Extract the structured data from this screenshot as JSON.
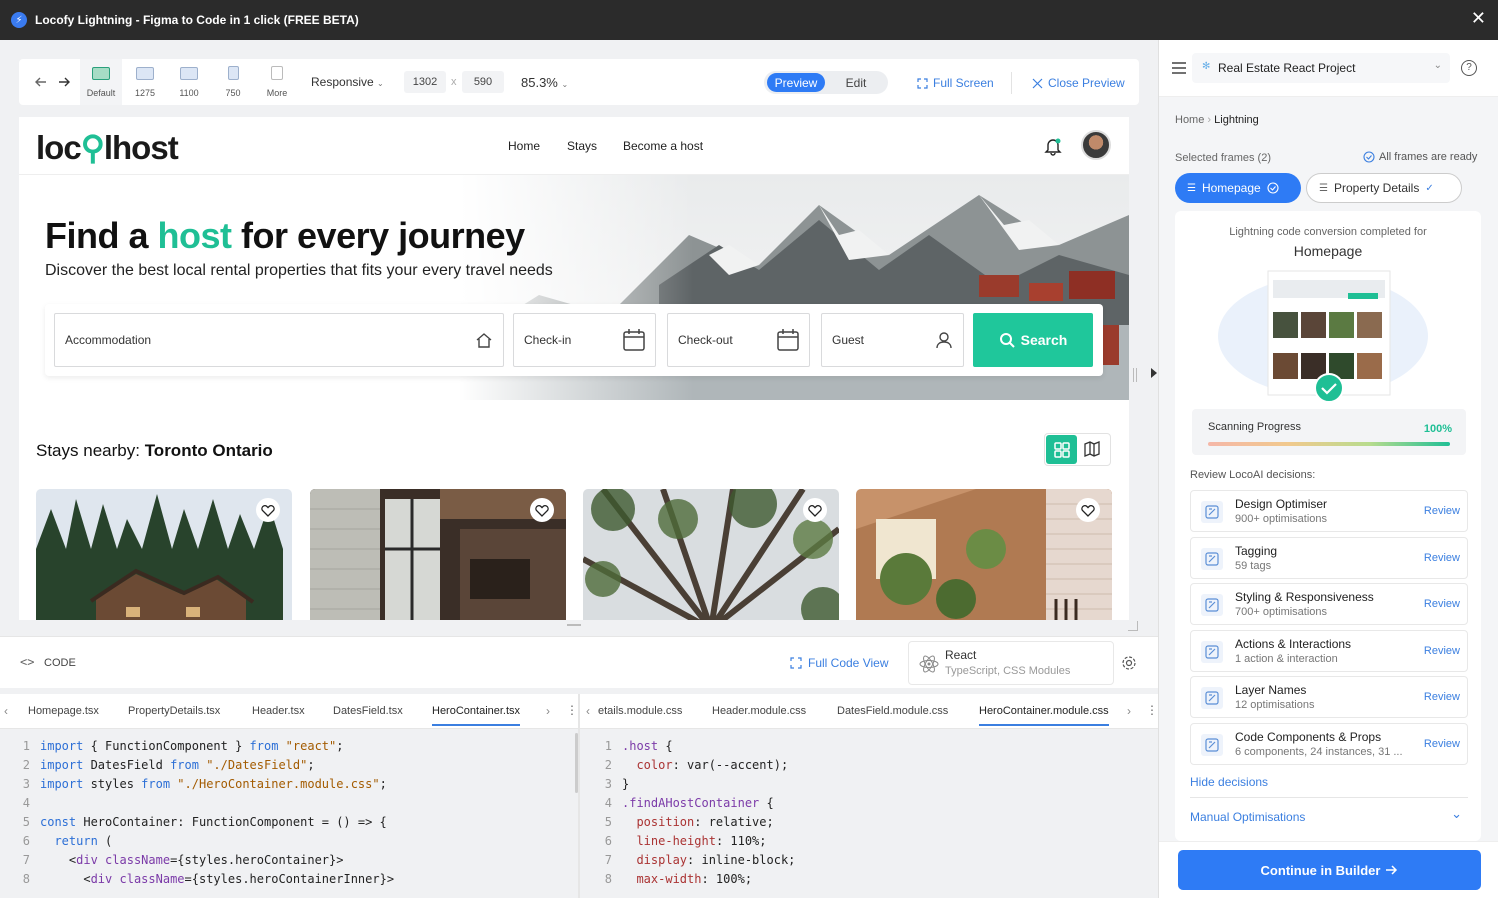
{
  "window": {
    "title": "Locofy Lightning - Figma to Code in 1 click (FREE BETA)"
  },
  "toolbar": {
    "devices": [
      {
        "label": "Default"
      },
      {
        "label": "1275"
      },
      {
        "label": "1100"
      },
      {
        "label": "750"
      },
      {
        "label": "More"
      }
    ],
    "responsive_label": "Responsive",
    "width_value": "1302",
    "times": "x",
    "height_value": "590",
    "zoom": "85.3%",
    "preview_label": "Preview",
    "edit_label": "Edit",
    "fullscreen_label": "Full Screen",
    "close_preview_label": "Close Preview"
  },
  "site": {
    "brand_pre": "loc",
    "brand_post": "lhost",
    "nav": [
      "Home",
      "Stays",
      "Become a host"
    ],
    "hero_title_pre": "Find a",
    "hero_title_host": "host",
    "hero_title_post": "for every journey",
    "hero_subtitle": "Discover the best local rental properties that fits your every travel needs",
    "search": {
      "accommodation": "Accommodation",
      "checkin": "Check-in",
      "checkout": "Check-out",
      "guest": "Guest",
      "button": "Search"
    },
    "stays_label": "Stays nearby:",
    "stays_location": "Toronto Ontario"
  },
  "code": {
    "section_label": "CODE",
    "full_code_view": "Full Code View",
    "framework": "React",
    "framework_sub": "TypeScript, CSS Modules",
    "tabs_left": [
      "Homepage.tsx",
      "PropertyDetails.tsx",
      "Header.tsx",
      "DatesField.tsx",
      "HeroContainer.tsx"
    ],
    "tabs_right": [
      "etails.module.css",
      "Header.module.css",
      "DatesField.module.css",
      "HeroContainer.module.css"
    ],
    "left_lines": [
      {
        "n": "1",
        "c": "import { FunctionComponent } from \"react\";"
      },
      {
        "n": "2",
        "c": "import DatesField from \"./DatesField\";"
      },
      {
        "n": "3",
        "c": "import styles from \"./HeroContainer.module.css\";"
      },
      {
        "n": "4",
        "c": ""
      },
      {
        "n": "5",
        "c": "const HeroContainer: FunctionComponent = () => {"
      },
      {
        "n": "6",
        "c": "  return ("
      },
      {
        "n": "7",
        "c": "    <div className={styles.heroContainer}>"
      },
      {
        "n": "8",
        "c": "      <div className={styles.heroContainerInner}>"
      }
    ],
    "right_lines": [
      {
        "n": "1",
        "c": ".host {"
      },
      {
        "n": "2",
        "c": "  color: var(--accent);"
      },
      {
        "n": "3",
        "c": "}"
      },
      {
        "n": "4",
        "c": ".findAHostContainer {"
      },
      {
        "n": "5",
        "c": "  position: relative;"
      },
      {
        "n": "6",
        "c": "  line-height: 110%;"
      },
      {
        "n": "7",
        "c": "  display: inline-block;"
      },
      {
        "n": "8",
        "c": "  max-width: 100%;"
      }
    ]
  },
  "panel": {
    "project": "Real Estate React Project",
    "breadcrumb_home": "Home",
    "breadcrumb_current": "Lightning",
    "selected_frames": "Selected frames (2)",
    "frames_ready": "All frames are ready",
    "frame_tabs": [
      "Homepage",
      "Property Details"
    ],
    "completed_text": "Lightning code conversion completed for",
    "completed_frame": "Homepage",
    "scanning_label": "Scanning Progress",
    "scanning_value": "100%",
    "scanning_progress": 1.0,
    "review_heading": "Review LocoAI decisions:",
    "decisions": [
      {
        "title": "Design Optimiser",
        "sub": "900+ optimisations",
        "action": "Review"
      },
      {
        "title": "Tagging",
        "sub": "59 tags",
        "action": "Review"
      },
      {
        "title": "Styling & Responsiveness",
        "sub": "700+ optimisations",
        "action": "Review"
      },
      {
        "title": "Actions & Interactions",
        "sub": "1 action & interaction",
        "action": "Review"
      },
      {
        "title": "Layer Names",
        "sub": "12 optimisations",
        "action": "Review"
      },
      {
        "title": "Code Components & Props",
        "sub": "6 components, 24 instances, 31 ...",
        "action": "Review"
      }
    ],
    "hide_decisions": "Hide decisions",
    "manual_optimisations": "Manual Optimisations",
    "continue_label": "Continue in Builder"
  },
  "colors": {
    "accent": "#1fbf95",
    "primary": "#2e7bf5",
    "titlebar": "#2b2b2b"
  }
}
